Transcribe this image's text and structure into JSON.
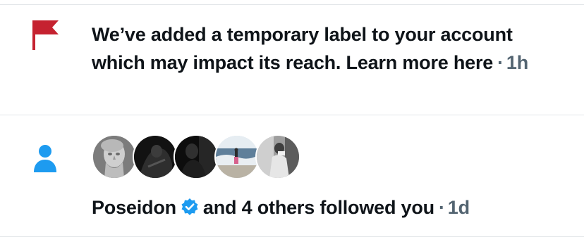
{
  "notifications": [
    {
      "icon": "flag-icon",
      "icon_color": "#c52230",
      "message": "We’ve added a temporary label to your account which may impact its reach. Learn more here",
      "separator": "·",
      "time": "1h"
    },
    {
      "icon": "person-icon",
      "icon_color": "#1d9bf0",
      "avatars": [
        "statue-avatar",
        "dark-avatar",
        "dark-figure-avatar",
        "beach-avatar",
        "mirror-avatar"
      ],
      "user_name": "Poseidon",
      "verified_badge": "verified-badge-icon",
      "verified_color": "#1d9bf0",
      "action": "and 4 others followed you",
      "separator": "·",
      "time": "1d"
    }
  ]
}
